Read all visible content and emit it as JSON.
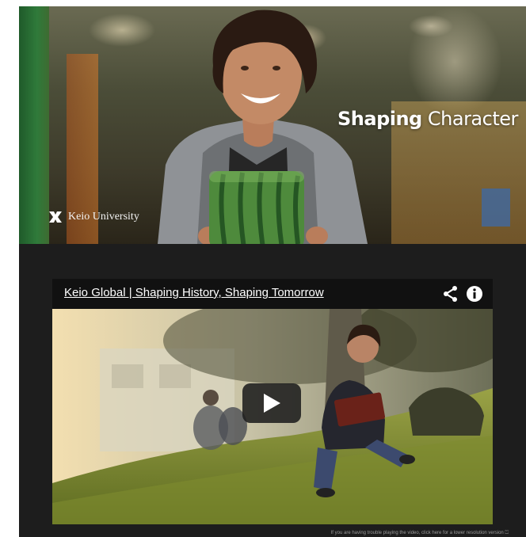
{
  "hero": {
    "tagline_bold": "Shaping",
    "tagline_light": "Character",
    "brand_name": "Keio University"
  },
  "video": {
    "title": "Keio Global | Shaping History, Shaping Tomorrow",
    "share_icon": "share-icon",
    "info_icon": "info-icon",
    "play_icon": "play-icon"
  },
  "footer": {
    "note": "If you are having trouble playing the video, click here for a lower resolution version ⏍"
  }
}
